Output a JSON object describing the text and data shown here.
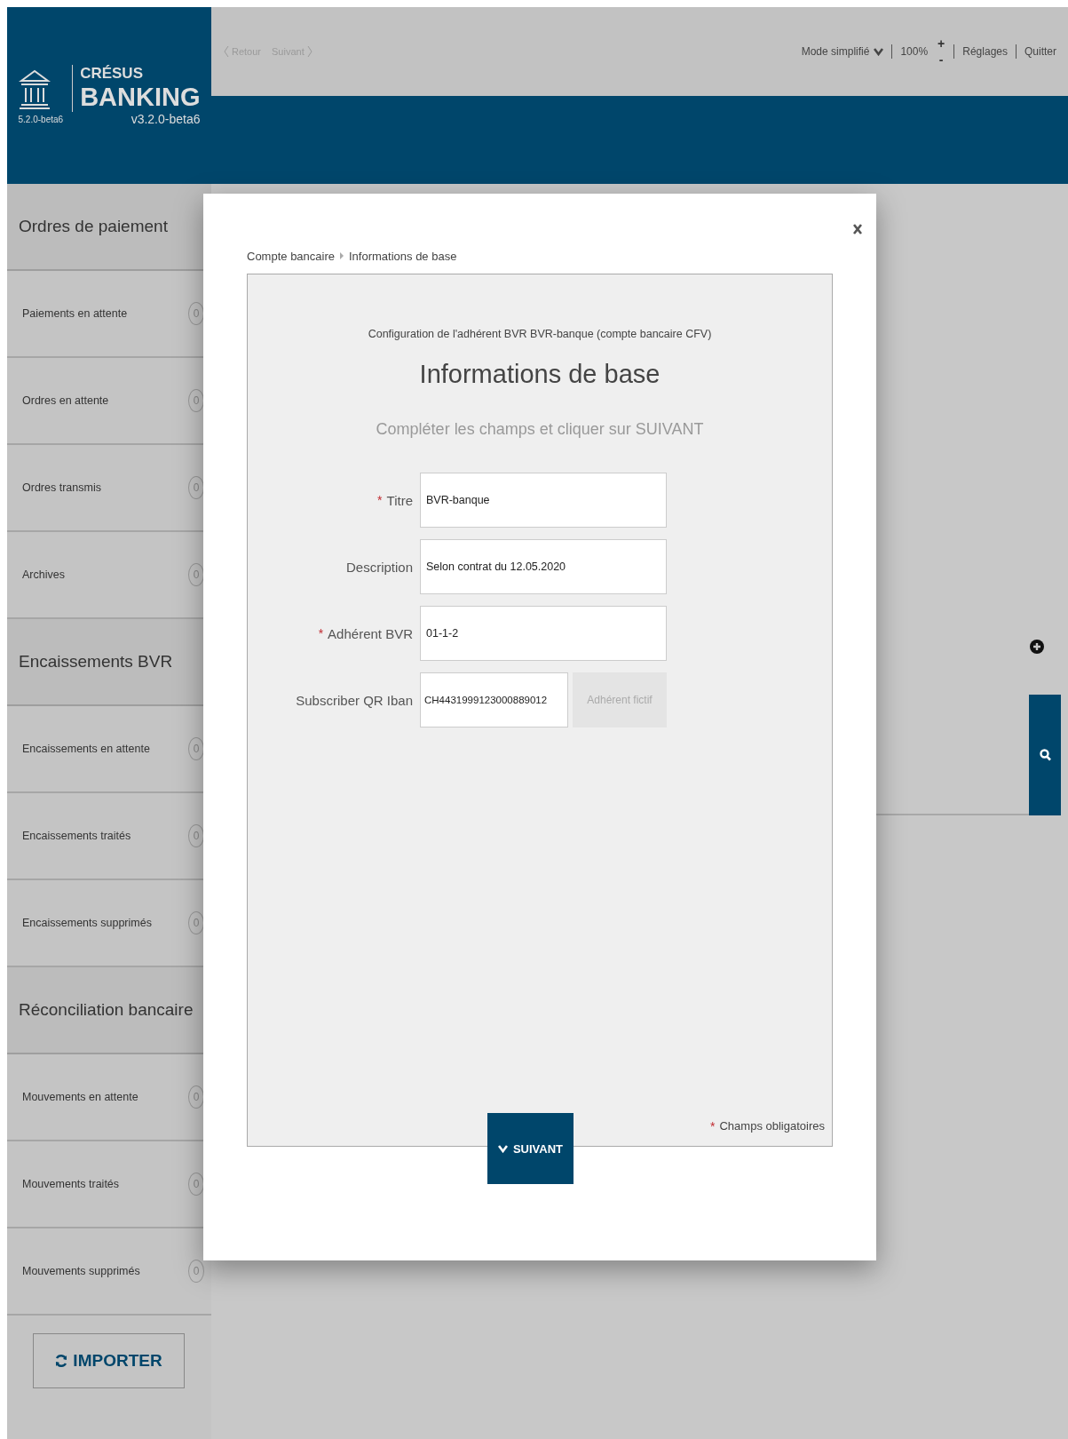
{
  "app": {
    "brand_top": "CRÉSUS",
    "brand_bottom": "BANKING",
    "version_left": "5.2.0-beta6",
    "version_right": "v3.2.0-beta6"
  },
  "toolbar": {
    "back": {
      "label": "Retour",
      "disabled": true
    },
    "forward": {
      "label": "Suivant",
      "disabled": true
    },
    "mode": "Mode simplifié",
    "zoom": "100%",
    "zoom_in": "+",
    "zoom_out": "-",
    "links": [
      "Réglages",
      "Quitter"
    ]
  },
  "sidebar": {
    "groups": [
      {
        "title": "Ordres de paiement",
        "items": [
          {
            "label": "Paiements en attente",
            "count": "0"
          },
          {
            "label": "Ordres en attente",
            "count": "0"
          },
          {
            "label": "Ordres transmis",
            "count": "0"
          },
          {
            "label": "Archives",
            "count": "0"
          }
        ]
      },
      {
        "title": "Encaissements BVR",
        "items": [
          {
            "label": "Encaissements en attente",
            "count": "0"
          },
          {
            "label": "Encaissements traités",
            "count": "0"
          },
          {
            "label": "Encaissements supprimés",
            "count": "0"
          }
        ]
      },
      {
        "title": "Réconciliation bancaire",
        "items": [
          {
            "label": "Mouvements en attente",
            "count": "0"
          },
          {
            "label": "Mouvements traités",
            "count": "0"
          },
          {
            "label": "Mouvements supprimés",
            "count": "0"
          }
        ]
      }
    ],
    "import_button": "IMPORTER"
  },
  "modal": {
    "breadcrumb": [
      "Compte bancaire",
      "Informations de base"
    ],
    "context": "Configuration de l'adhérent BVR BVR-banque (compte bancaire CFV)",
    "title": "Informations de base",
    "instruction": "Compléter les champs et cliquer sur SUIVANT",
    "fields": [
      {
        "kind": "text",
        "label": "Titre",
        "required": true,
        "value": "BVR-banque"
      },
      {
        "kind": "text",
        "label": "Description",
        "required": false,
        "value": "Selon contrat du 12.05.2020"
      },
      {
        "kind": "text",
        "label": "Adhérent BVR",
        "required": true,
        "value": "01-1-2"
      },
      {
        "kind": "text_with_button",
        "label": "Subscriber QR Iban",
        "required": false,
        "value": "CH4431999123000889012",
        "button": {
          "label": "Adhérent fictif",
          "disabled": true
        }
      }
    ],
    "required_mark": "*",
    "required_note": "Champs obligatoires",
    "next_button": "SUIVANT"
  }
}
